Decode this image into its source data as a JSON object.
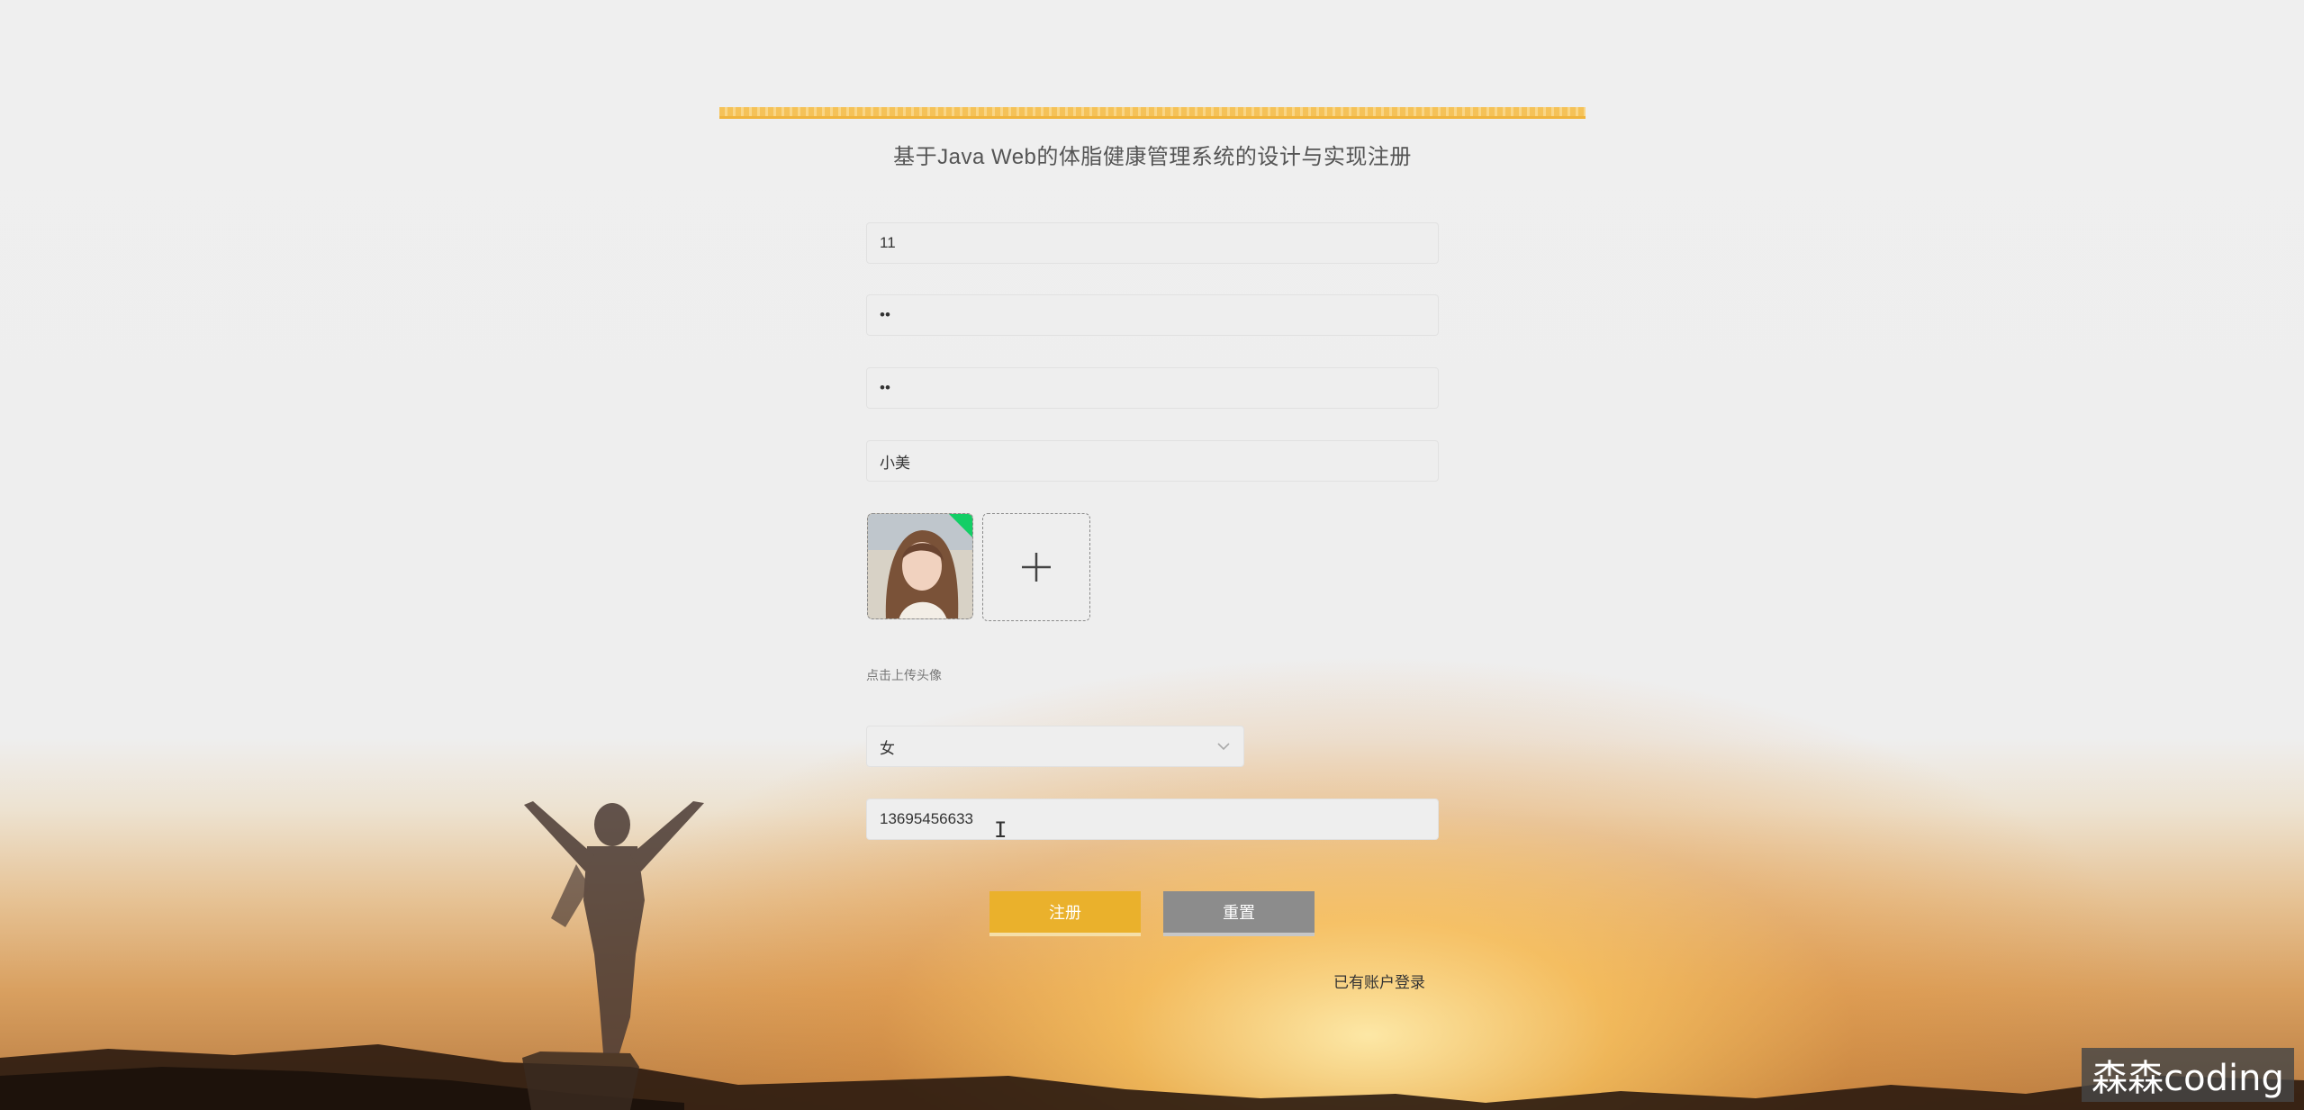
{
  "page": {
    "title": "基于Java Web的体脂健康管理系统的设计与实现注册"
  },
  "form": {
    "account_value": "11",
    "password_value": "••",
    "confirm_password_value": "••",
    "name_value": "小美",
    "upload_hint": "点击上传头像",
    "gender_value": "女",
    "phone_value": "13695456633"
  },
  "buttons": {
    "register_label": "注册",
    "reset_label": "重置"
  },
  "links": {
    "login_label": "已有账户登录"
  },
  "overlay": {
    "watermark": "森森coding"
  },
  "colors": {
    "accent": "#eab12c",
    "reset": "#8c8c8c",
    "upload_success": "#13ce66"
  },
  "icons": {
    "upload": "plus-icon",
    "select": "chevron-down-icon"
  }
}
